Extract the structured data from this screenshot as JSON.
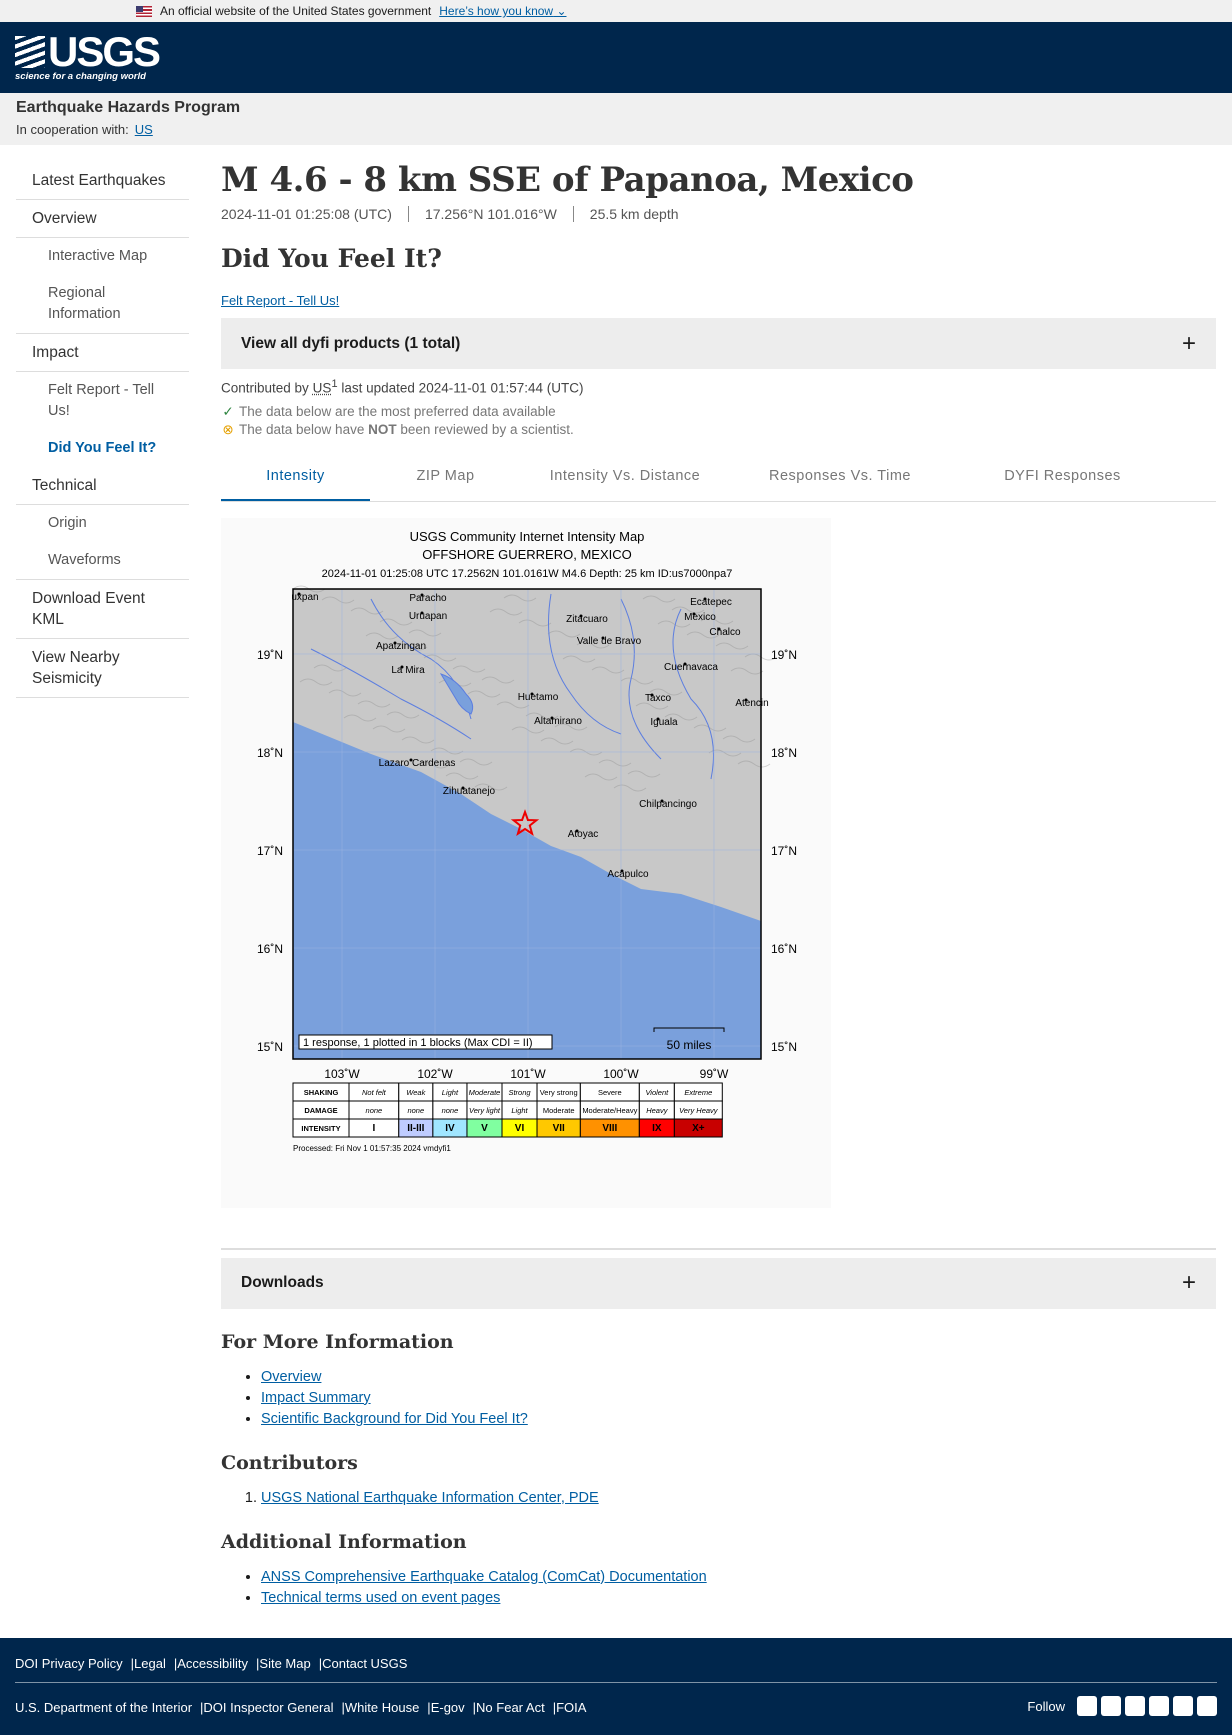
{
  "govbar": {
    "text": "An official website of the United States government",
    "link": "Here’s how you know"
  },
  "logo": {
    "text": "USGS",
    "tagline": "science for a changing world"
  },
  "program": {
    "title": "Earthquake Hazards Program",
    "coop_label": "In cooperation with:",
    "coop_link": "US"
  },
  "sidebar": [
    {
      "label": "Latest Earthquakes",
      "type": "top"
    },
    {
      "label": "Overview",
      "type": "top"
    },
    {
      "label": "Interactive Map",
      "type": "sub"
    },
    {
      "label": "Regional Information",
      "type": "sub-last"
    },
    {
      "label": "Impact",
      "type": "top"
    },
    {
      "label": "Felt Report - Tell Us!",
      "type": "sub"
    },
    {
      "label": "Did You Feel It?",
      "type": "sub-active"
    },
    {
      "label": "Technical",
      "type": "top"
    },
    {
      "label": "Origin",
      "type": "sub"
    },
    {
      "label": "Waveforms",
      "type": "sub-last"
    },
    {
      "label": "Download Event KML",
      "type": "top"
    },
    {
      "label": "View Nearby Seismicity",
      "type": "top"
    }
  ],
  "event": {
    "title": "M 4.6 - 8 km SSE of Papanoa, Mexico",
    "time": "2024-11-01 01:25:08 (UTC)",
    "coords": "17.256°N 101.016°W",
    "depth": "25.5 km depth"
  },
  "section": {
    "title": "Did You Feel It?",
    "felt_link": "Felt Report - Tell Us!",
    "products": "View all dyfi products (1 total)"
  },
  "contrib": {
    "prefix": "Contributed by",
    "source": "US",
    "sup": "1",
    "updated": "last updated 2024-11-01 01:57:44 (UTC)",
    "pref": "The data below are the most preferred data available",
    "review_a": "The data below have",
    "review_b": "NOT",
    "review_c": "been reviewed by a scientist."
  },
  "tabs": [
    "Intensity",
    "ZIP Map",
    "Intensity Vs. Distance",
    "Responses Vs. Time",
    "DYFI Responses"
  ],
  "map": {
    "title1": "USGS Community Internet Intensity Map",
    "title2": "OFFSHORE GUERRERO, MEXICO",
    "title3": "2024-11-01 01:25:08 UTC 17.2562N 101.0161W M4.6 Depth: 25 km ID:us7000npa7",
    "lat_labels": [
      "19˚N",
      "18˚N",
      "17˚N",
      "16˚N",
      "15˚N"
    ],
    "lon_labels": [
      "103˚W",
      "102˚W",
      "101˚W",
      "100˚W",
      "99˚W"
    ],
    "cities": [
      "uxpan",
      "Paracho",
      "Uruapan",
      "Apatzingan",
      "La Mira",
      "Zitacuaro",
      "Valle de Bravo",
      "Ecatepec",
      "Mexico",
      "Chalco",
      "Cuernavaca",
      "Huetamo",
      "Altamirano",
      "Taxco",
      "Iguala",
      "Atencin",
      "Lazaro Cardenas",
      "Zihuatanejo",
      "Chilpancingo",
      "Atoyac",
      "Acapulco"
    ],
    "response_note": "1 response, 1 plotted in 1 blocks (Max CDI = II)",
    "scale": "50 miles",
    "legend_heads": [
      "SHAKING",
      "DAMAGE",
      "INTENSITY"
    ],
    "shaking": [
      "Not felt",
      "Weak",
      "Light",
      "Moderate",
      "Strong",
      "Very strong",
      "Severe",
      "Violent",
      "Extreme"
    ],
    "damage": [
      "none",
      "none",
      "none",
      "Very light",
      "Light",
      "Moderate",
      "Moderate/Heavy",
      "Heavy",
      "Very Heavy"
    ],
    "intensity": [
      "I",
      "II-III",
      "IV",
      "V",
      "VI",
      "VII",
      "VIII",
      "IX",
      "X+"
    ],
    "intensity_colors": [
      "#ffffff",
      "#bfccff",
      "#a0e6ff",
      "#80ffa0",
      "#ffff00",
      "#ffc800",
      "#ff9100",
      "#ff0000",
      "#c80000"
    ],
    "processed": "Processed: Fri Nov  1 01:57:35 2024 vmdyfi1"
  },
  "downloads": "Downloads",
  "more": {
    "title": "For More Information",
    "links": [
      "Overview",
      "Impact Summary",
      "Scientific Background for Did You Feel It?"
    ]
  },
  "contributors": {
    "title": "Contributors",
    "links": [
      "USGS National Earthquake Information Center, PDE"
    ]
  },
  "additional": {
    "title": "Additional Information",
    "links": [
      "ANSS Comprehensive Earthquake Catalog (ComCat) Documentation",
      "Technical terms used on event pages"
    ]
  },
  "footer": {
    "row1": [
      "DOI Privacy Policy",
      "Legal",
      "Accessibility",
      "Site Map",
      "Contact USGS"
    ],
    "row2": [
      "U.S. Department of the Interior",
      "DOI Inspector General",
      "White House",
      "E-gov",
      "No Fear Act",
      "FOIA"
    ],
    "follow": "Follow",
    "social": [
      "twitter-icon",
      "facebook-icon",
      "github-icon",
      "flickr-icon",
      "youtube-icon",
      "instagram-icon"
    ]
  }
}
